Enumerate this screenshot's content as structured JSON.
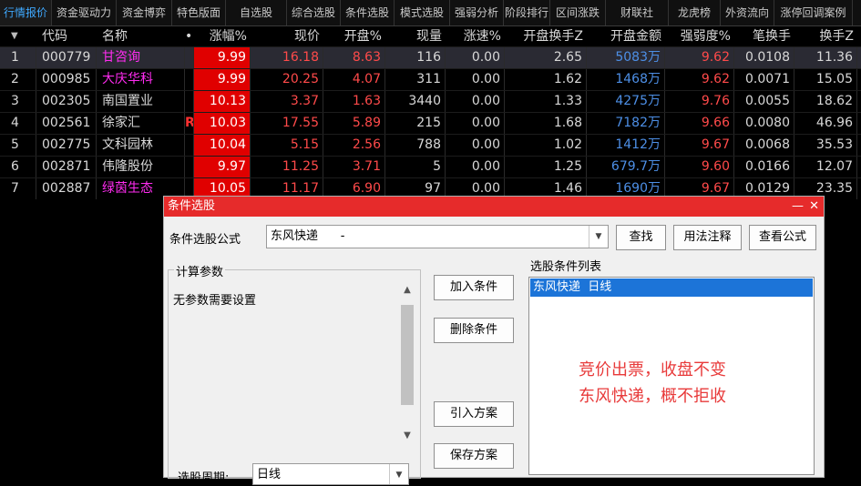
{
  "tabs": [
    "行情报价",
    "资金驱动力",
    "资金博弈",
    "特色版面",
    "自选股",
    "综合选股",
    "条件选股",
    "模式选股",
    "强弱分析",
    "阶段排行",
    "区间涨跌",
    "财联社",
    "龙虎榜",
    "外资流向",
    "涨停回调案例"
  ],
  "columns": [
    "",
    "代码",
    "名称",
    "•",
    "涨幅%",
    "现价",
    "开盘%",
    "现量",
    "涨速%",
    "开盘换手Z",
    "开盘金额",
    "强弱度%",
    "笔换手",
    "换手Z"
  ],
  "rows": [
    {
      "idx": "1",
      "code": "000779",
      "name": "甘咨询",
      "name_color": "magenta",
      "mark": "",
      "pct": "9.99",
      "price": "16.18",
      "open_pct": "8.63",
      "vol": "116",
      "speed": "0.00",
      "open_turn": "2.65",
      "open_amt": "5083万",
      "strength": "9.62",
      "per_turn": "0.0108",
      "turn": "11.36"
    },
    {
      "idx": "2",
      "code": "000985",
      "name": "大庆华科",
      "name_color": "magenta",
      "mark": "",
      "pct": "9.99",
      "price": "20.25",
      "open_pct": "4.07",
      "vol": "311",
      "speed": "0.00",
      "open_turn": "1.62",
      "open_amt": "1468万",
      "strength": "9.62",
      "per_turn": "0.0071",
      "turn": "15.05"
    },
    {
      "idx": "3",
      "code": "002305",
      "name": "南国置业",
      "name_color": "white",
      "mark": "",
      "pct": "10.13",
      "price": "3.37",
      "open_pct": "1.63",
      "vol": "3440",
      "speed": "0.00",
      "open_turn": "1.33",
      "open_amt": "4275万",
      "strength": "9.76",
      "per_turn": "0.0055",
      "turn": "18.62"
    },
    {
      "idx": "4",
      "code": "002561",
      "name": "徐家汇",
      "name_color": "white",
      "mark": "R",
      "pct": "10.03",
      "price": "17.55",
      "open_pct": "5.89",
      "vol": "215",
      "speed": "0.00",
      "open_turn": "1.68",
      "open_amt": "7182万",
      "strength": "9.66",
      "per_turn": "0.0080",
      "turn": "46.96"
    },
    {
      "idx": "5",
      "code": "002775",
      "name": "文科园林",
      "name_color": "white",
      "mark": "",
      "pct": "10.04",
      "price": "5.15",
      "open_pct": "2.56",
      "vol": "788",
      "speed": "0.00",
      "open_turn": "1.02",
      "open_amt": "1412万",
      "strength": "9.67",
      "per_turn": "0.0068",
      "turn": "35.53"
    },
    {
      "idx": "6",
      "code": "002871",
      "name": "伟隆股份",
      "name_color": "white",
      "mark": "",
      "pct": "9.97",
      "price": "11.25",
      "open_pct": "3.71",
      "vol": "5",
      "speed": "0.00",
      "open_turn": "1.25",
      "open_amt": "679.7万",
      "strength": "9.60",
      "per_turn": "0.0166",
      "turn": "12.07"
    },
    {
      "idx": "7",
      "code": "002887",
      "name": "绿茵生态",
      "name_color": "magenta",
      "mark": "",
      "pct": "10.05",
      "price": "11.17",
      "open_pct": "6.90",
      "vol": "97",
      "speed": "0.00",
      "open_turn": "1.46",
      "open_amt": "1690万",
      "strength": "9.67",
      "per_turn": "0.0129",
      "turn": "23.35"
    }
  ],
  "dialog": {
    "title": "条件选股",
    "formula_label": "条件选股公式",
    "formula_value": "东风快递      -",
    "find_btn": "查找",
    "usage_btn": "用法注释",
    "view_btn": "查看公式",
    "params_group": "计算参数",
    "params_text": "无参数需要设置",
    "add_btn": "加入条件",
    "delete_btn": "删除条件",
    "import_btn": "引入方案",
    "save_btn": "保存方案",
    "list_label": "选股条件列表",
    "list_item": "东风快递  日线",
    "period_label": "选股周期:",
    "period_value": "日线",
    "note_line1": "竞价出票，收盘不变",
    "note_line2": "东风快递，概不拒收"
  }
}
